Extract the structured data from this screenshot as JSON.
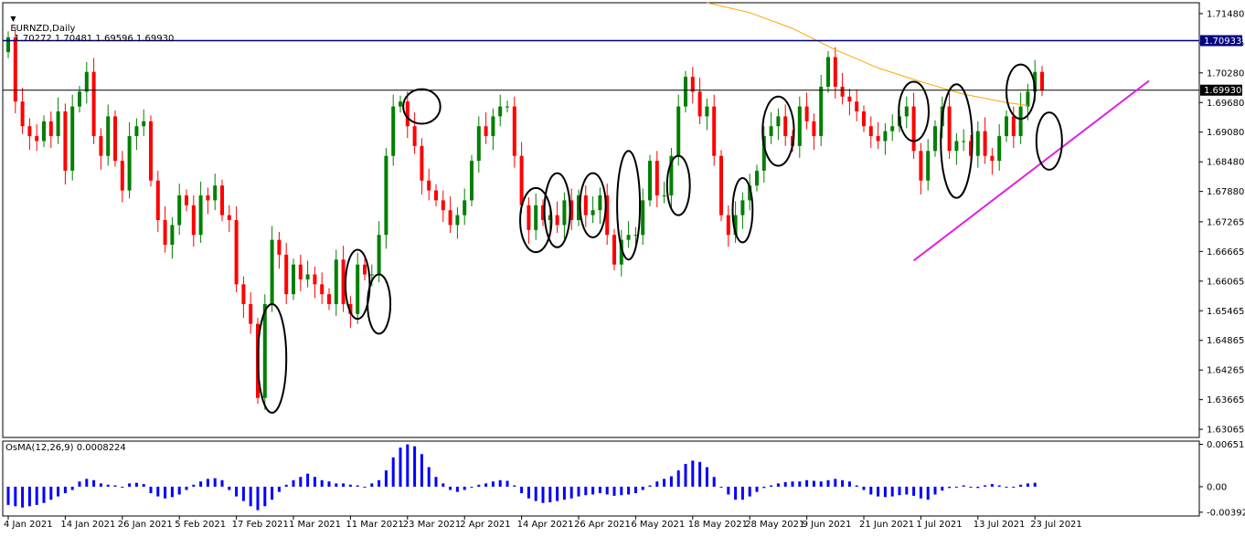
{
  "header": {
    "arrow": "▼",
    "symbol": "EURNZD,Daily",
    "ohlc": "1.70272 1.70481 1.69596 1.69930"
  },
  "indicator": {
    "label": "OsMA(12,26,9) 0.0008224",
    "axis_labels": [
      "0.0065101",
      "0.00",
      "-0.003921"
    ]
  },
  "colors": {
    "bull": "#008000",
    "bear": "#ff0000",
    "ma": "#ffa500",
    "resistance": "#000080",
    "price_line": "#000000",
    "trendline": "#e020e0",
    "histogram": "#0000ff",
    "circle": "#000000"
  },
  "chart_data": {
    "type": "candlestick",
    "ylim": [
      1.629,
      1.717
    ],
    "y_ticks": [
      "1.71480",
      "1.70885",
      "1.70280",
      "1.69680",
      "1.69080",
      "1.68480",
      "1.67880",
      "1.67265",
      "1.66665",
      "1.66065",
      "1.65465",
      "1.64865",
      "1.64265",
      "1.63665",
      "1.63065"
    ],
    "x_labels": [
      {
        "label": "4 Jan 2021",
        "i": 0
      },
      {
        "label": "14 Jan 2021",
        "i": 8
      },
      {
        "label": "26 Jan 2021",
        "i": 16
      },
      {
        "label": "5 Feb 2021",
        "i": 24
      },
      {
        "label": "17 Feb 2021",
        "i": 32
      },
      {
        "label": "1 Mar 2021",
        "i": 40
      },
      {
        "label": "11 Mar 2021",
        "i": 48
      },
      {
        "label": "23 Mar 2021",
        "i": 56
      },
      {
        "label": "2 Apr 2021",
        "i": 64
      },
      {
        "label": "14 Apr 2021",
        "i": 72
      },
      {
        "label": "26 Apr 2021",
        "i": 80
      },
      {
        "label": "6 May 2021",
        "i": 88
      },
      {
        "label": "18 May 2021",
        "i": 96
      },
      {
        "label": "28 May 2021",
        "i": 104
      },
      {
        "label": "9 Jun 2021",
        "i": 112
      },
      {
        "label": "21 Jun 2021",
        "i": 120
      },
      {
        "label": "1 Jul 2021",
        "i": 128
      },
      {
        "label": "13 Jul 2021",
        "i": 136
      },
      {
        "label": "23 Jul 2021",
        "i": 144
      }
    ],
    "closes": [
      1.71,
      1.697,
      1.692,
      1.69,
      1.689,
      1.693,
      1.69,
      1.695,
      1.683,
      1.696,
      1.699,
      1.703,
      1.69,
      1.686,
      1.694,
      1.685,
      1.679,
      1.69,
      1.692,
      1.693,
      1.681,
      1.673,
      1.668,
      1.672,
      1.678,
      1.676,
      1.67,
      1.678,
      1.677,
      1.68,
      1.674,
      1.673,
      1.66,
      1.656,
      1.652,
      1.637,
      1.656,
      1.669,
      1.666,
      1.658,
      1.664,
      1.661,
      1.662,
      1.66,
      1.658,
      1.656,
      1.665,
      1.656,
      1.654,
      1.664,
      1.662,
      1.662,
      1.67,
      1.686,
      1.696,
      1.697,
      1.692,
      1.688,
      1.681,
      1.679,
      1.677,
      1.675,
      1.672,
      1.674,
      1.677,
      1.685,
      1.692,
      1.69,
      1.694,
      1.696,
      1.696,
      1.686,
      1.676,
      1.671,
      1.676,
      1.673,
      1.674,
      1.672,
      1.677,
      1.673,
      1.678,
      1.674,
      1.675,
      1.678,
      1.67,
      1.664,
      1.669,
      1.67,
      1.67,
      1.677,
      1.685,
      1.678,
      1.678,
      1.686,
      1.696,
      1.702,
      1.699,
      1.694,
      1.696,
      1.686,
      1.674,
      1.67,
      1.674,
      1.677,
      1.68,
      1.683,
      1.69,
      1.692,
      1.694,
      1.69,
      1.688,
      1.696,
      1.693,
      1.69,
      1.7,
      1.706,
      1.7,
      1.698,
      1.697,
      1.695,
      1.692,
      1.69,
      1.689,
      1.691,
      1.692,
      1.694,
      1.696,
      1.687,
      1.681,
      1.687,
      1.692,
      1.696,
      1.687,
      1.689,
      1.689,
      1.686,
      1.691,
      1.686,
      1.685,
      1.69,
      1.694,
      1.69,
      1.696,
      1.699,
      1.703,
      1.6993
    ],
    "ma": [
      {
        "i": 98,
        "v": 1.717
      },
      {
        "i": 104,
        "v": 1.715
      },
      {
        "i": 110,
        "v": 1.7118
      },
      {
        "i": 116,
        "v": 1.7075
      },
      {
        "i": 122,
        "v": 1.7038
      },
      {
        "i": 128,
        "v": 1.701
      },
      {
        "i": 134,
        "v": 1.6985
      },
      {
        "i": 140,
        "v": 1.6968
      },
      {
        "i": 143,
        "v": 1.6962
      }
    ],
    "resistance": {
      "value": 1.70933,
      "label": "1.70933"
    },
    "current_price": {
      "value": 1.6993,
      "label": "1.69930"
    },
    "trendline": {
      "from": {
        "i": 127,
        "v": 1.6648
      },
      "to": {
        "i": 160,
        "v": 1.7012
      }
    },
    "circles": [
      {
        "i": 37,
        "v": 1.645,
        "rx": 2.0,
        "ry": 0.011
      },
      {
        "i": 49,
        "v": 1.66,
        "rx": 1.7,
        "ry": 0.007
      },
      {
        "i": 52,
        "v": 1.656,
        "rx": 1.6,
        "ry": 0.006
      },
      {
        "i": 58,
        "v": 1.696,
        "rx": 2.6,
        "ry": 0.0035
      },
      {
        "i": 74,
        "v": 1.673,
        "rx": 2.2,
        "ry": 0.0065
      },
      {
        "i": 77,
        "v": 1.675,
        "rx": 1.8,
        "ry": 0.0075
      },
      {
        "i": 82,
        "v": 1.676,
        "rx": 1.8,
        "ry": 0.0065
      },
      {
        "i": 87,
        "v": 1.676,
        "rx": 1.6,
        "ry": 0.011
      },
      {
        "i": 94,
        "v": 1.68,
        "rx": 1.6,
        "ry": 0.006
      },
      {
        "i": 103,
        "v": 1.675,
        "rx": 1.4,
        "ry": 0.0065
      },
      {
        "i": 108,
        "v": 1.691,
        "rx": 2.2,
        "ry": 0.007
      },
      {
        "i": 127,
        "v": 1.695,
        "rx": 2.1,
        "ry": 0.006
      },
      {
        "i": 133,
        "v": 1.689,
        "rx": 2.2,
        "ry": 0.0115
      },
      {
        "i": 142,
        "v": 1.699,
        "rx": 2.0,
        "ry": 0.0055
      },
      {
        "i": 146,
        "v": 1.689,
        "rx": 1.8,
        "ry": 0.0058
      }
    ],
    "osma": {
      "ylim": [
        -0.0045,
        0.007
      ],
      "values": [
        -0.0028,
        -0.003,
        -0.0032,
        -0.003,
        -0.0028,
        -0.0025,
        -0.002,
        -0.0015,
        -0.001,
        -0.0005,
        0.0008,
        0.0012,
        0.001,
        0.0005,
        0.0003,
        0.0002,
        0.0,
        0.0005,
        0.0006,
        0.0004,
        -0.001,
        -0.0015,
        -0.0018,
        -0.0016,
        -0.0012,
        -0.0005,
        0.0003,
        0.0008,
        0.0012,
        0.0013,
        0.001,
        -0.0005,
        -0.0015,
        -0.0022,
        -0.003,
        -0.0036,
        -0.003,
        -0.002,
        -0.0008,
        0.0003,
        0.001,
        0.0015,
        0.002,
        0.0015,
        0.001,
        0.0008,
        0.0005,
        0.0005,
        0.0003,
        0.0002,
        0.0,
        0.0005,
        0.001,
        0.0025,
        0.0045,
        0.006,
        0.0065,
        0.0062,
        0.005,
        0.003,
        0.0015,
        0.0005,
        -0.0005,
        -0.0008,
        -0.0005,
        0.0,
        0.0003,
        0.0005,
        0.0008,
        0.001,
        0.0009,
        0.0002,
        -0.001,
        -0.0018,
        -0.0022,
        -0.0025,
        -0.0024,
        -0.0022,
        -0.002,
        -0.0018,
        -0.0015,
        -0.0013,
        -0.0012,
        -0.001,
        -0.0012,
        -0.0014,
        -0.0013,
        -0.0012,
        -0.001,
        -0.0005,
        0.0002,
        0.0008,
        0.0012,
        0.0016,
        0.0025,
        0.0035,
        0.004,
        0.0038,
        0.003,
        0.0015,
        0.0,
        -0.0012,
        -0.002,
        -0.002,
        -0.0015,
        -0.0008,
        -0.0002,
        0.0002,
        0.0005,
        0.0007,
        0.0008,
        0.0008,
        0.001,
        0.0009,
        0.0008,
        0.001,
        0.0012,
        0.001,
        0.0008,
        0.0002,
        -0.0005,
        -0.0012,
        -0.0015,
        -0.0016,
        -0.0015,
        -0.0013,
        -0.0012,
        -0.0014,
        -0.0018,
        -0.002,
        -0.0012,
        -0.0006,
        -0.0002,
        0.0,
        0.0002,
        0.0,
        -0.0002,
        0.0002,
        0.0004,
        0.0002,
        0.0,
        -0.0001,
        0.0003,
        0.0005,
        0.0006
      ]
    }
  }
}
